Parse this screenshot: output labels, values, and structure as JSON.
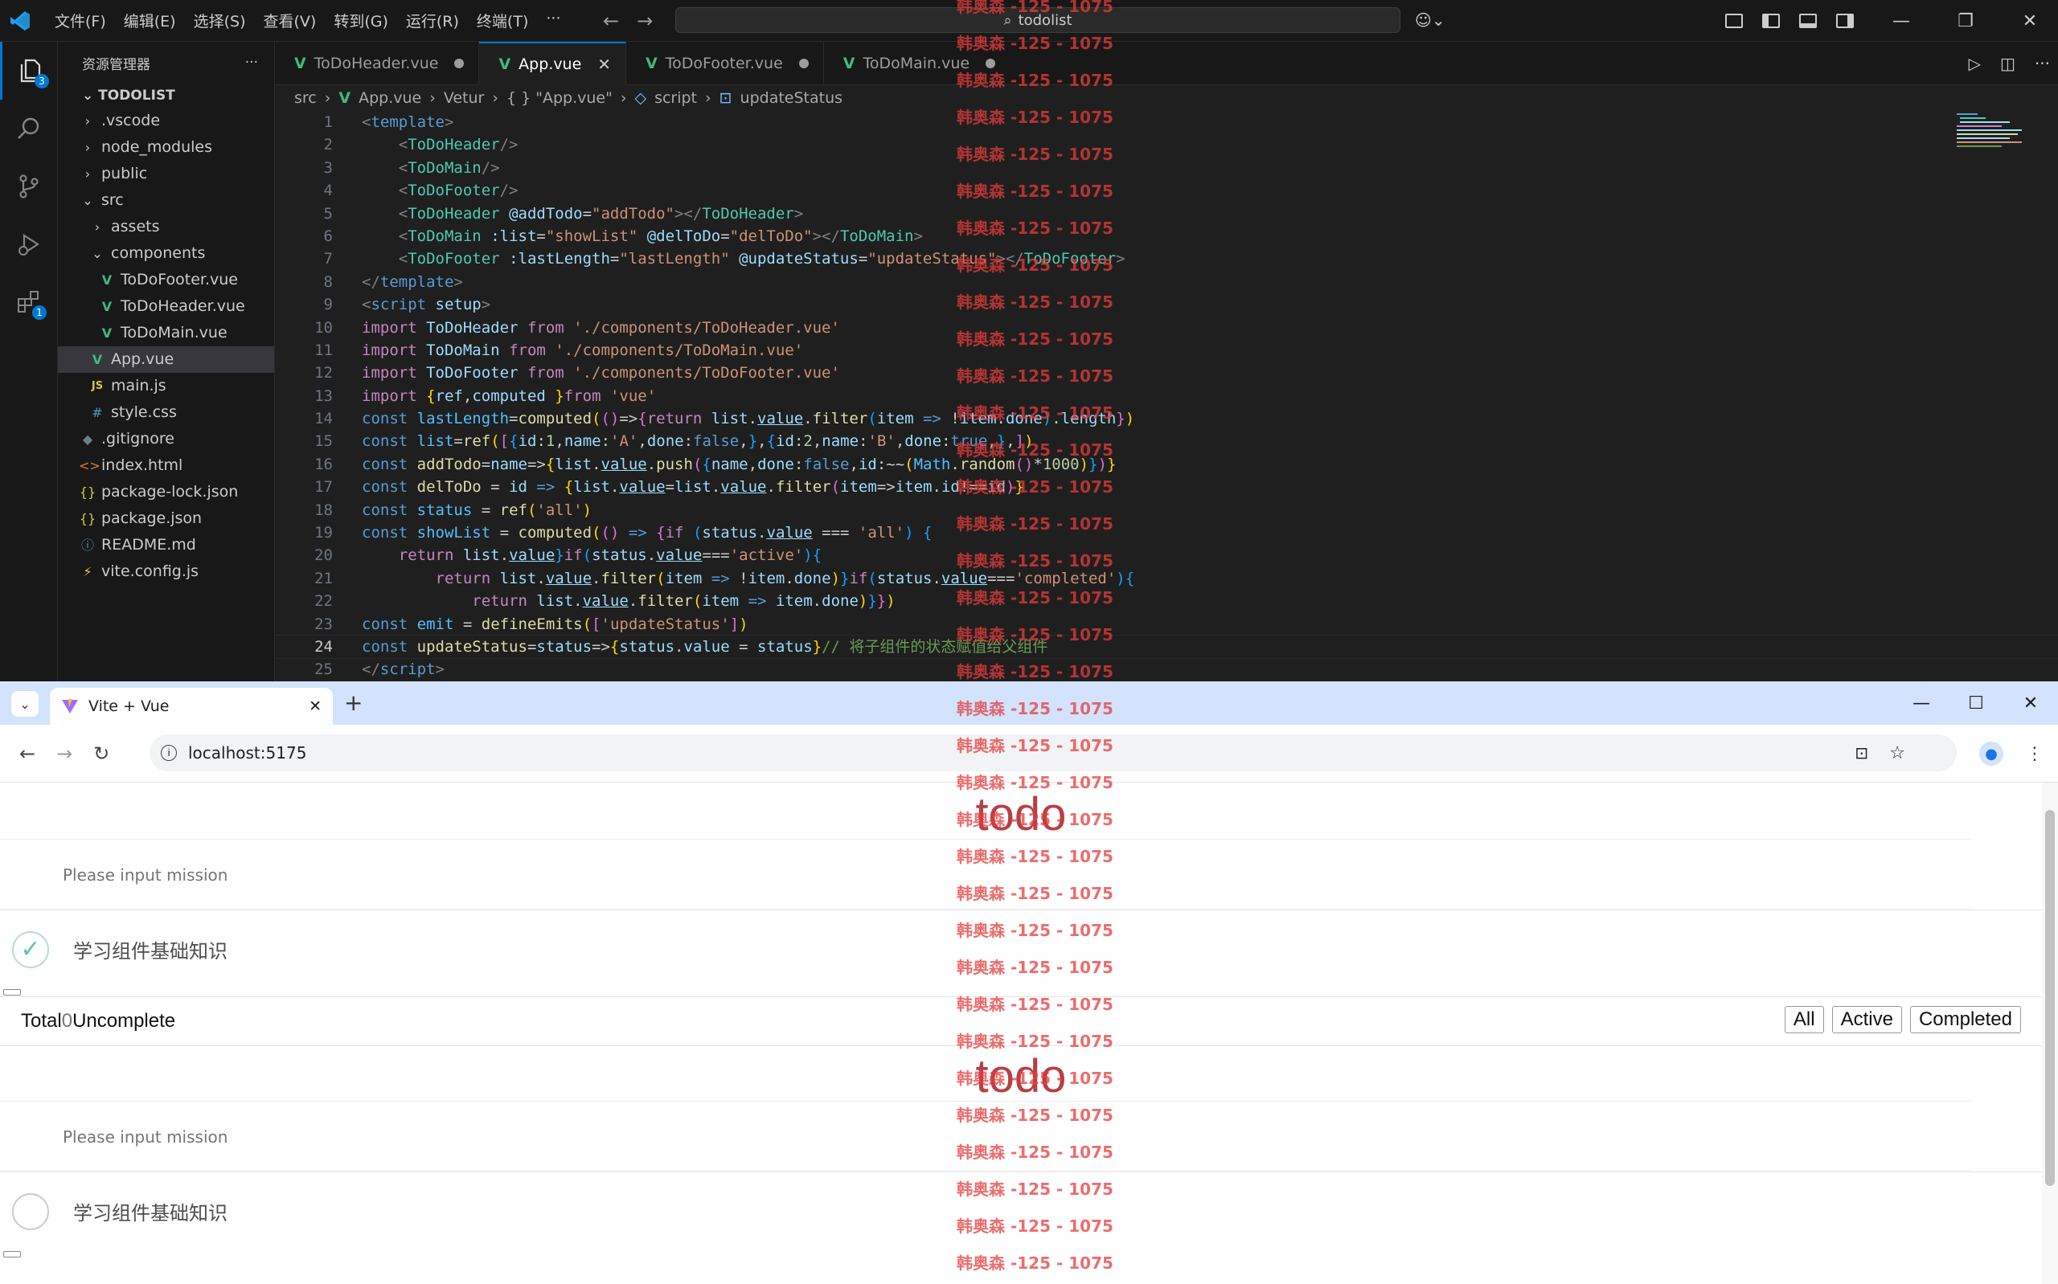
{
  "vscode": {
    "menu": [
      "文件(F)",
      "编辑(E)",
      "选择(S)",
      "查看(V)",
      "转到(G)",
      "运行(R)",
      "终端(T)",
      "···"
    ],
    "search": "todolist",
    "explorer_title": "资源管理器",
    "explorer_more": "···",
    "root": "TODOLIST",
    "badges": {
      "explorer": "3",
      "extensions": "1"
    },
    "tree": [
      {
        "label": ".vscode",
        "icon": "›",
        "depth": 1
      },
      {
        "label": "node_modules",
        "icon": "›",
        "depth": 1
      },
      {
        "label": "public",
        "icon": "›",
        "depth": 1
      },
      {
        "label": "src",
        "icon": "⌄",
        "depth": 1
      },
      {
        "label": "assets",
        "icon": "›",
        "depth": 2
      },
      {
        "label": "components",
        "icon": "⌄",
        "depth": 2
      },
      {
        "label": "ToDoFooter.vue",
        "icon": "V",
        "depth": 3
      },
      {
        "label": "ToDoHeader.vue",
        "icon": "V",
        "depth": 3
      },
      {
        "label": "ToDoMain.vue",
        "icon": "V",
        "depth": 3
      },
      {
        "label": "App.vue",
        "icon": "V",
        "depth": 2
      },
      {
        "label": "main.js",
        "icon": "JS",
        "depth": 2
      },
      {
        "label": "style.css",
        "icon": "#",
        "depth": 2
      },
      {
        "label": ".gitignore",
        "icon": "◆",
        "depth": 1
      },
      {
        "label": "index.html",
        "icon": "<>",
        "depth": 1
      },
      {
        "label": "package-lock.json",
        "icon": "{}",
        "depth": 1
      },
      {
        "label": "package.json",
        "icon": "{}",
        "depth": 1
      },
      {
        "label": "README.md",
        "icon": "ⓘ",
        "depth": 1
      },
      {
        "label": "vite.config.js",
        "icon": "⚡",
        "depth": 1
      }
    ],
    "tabs": [
      {
        "label": "ToDoHeader.vue"
      },
      {
        "label": "App.vue"
      },
      {
        "label": "ToDoFooter.vue"
      },
      {
        "label": "ToDoMain.vue"
      }
    ],
    "breadcrumb": [
      "src",
      "App.vue",
      "Vetur",
      "{ } \"App.vue\"",
      "script",
      "updateStatus"
    ],
    "line_numbers": [
      "1",
      "2",
      "3",
      "4",
      "5",
      "6",
      "7",
      "8",
      "9",
      "10",
      "11",
      "12",
      "13",
      "14",
      "15",
      "16",
      "17",
      "18",
      "19",
      "20",
      "21",
      "22",
      "23",
      "24",
      "25"
    ],
    "current_line": "24"
  },
  "browser": {
    "tab_title": "Vite + Vue",
    "url": "localhost:5175",
    "sections": [
      {
        "title": "todo",
        "placeholder": "Please input mission",
        "item": "学习组件基础知识",
        "item_done": true
      },
      {
        "title": "todo",
        "placeholder": "Please input mission",
        "item": "学习组件基础知识",
        "item_done": false
      }
    ],
    "footer": {
      "total": "Total",
      "count": "0",
      "uncomplete": "Uncomplete",
      "buttons": [
        "All",
        "Active",
        "Completed"
      ]
    }
  },
  "watermark": "韩奥森 -125 - 1075"
}
